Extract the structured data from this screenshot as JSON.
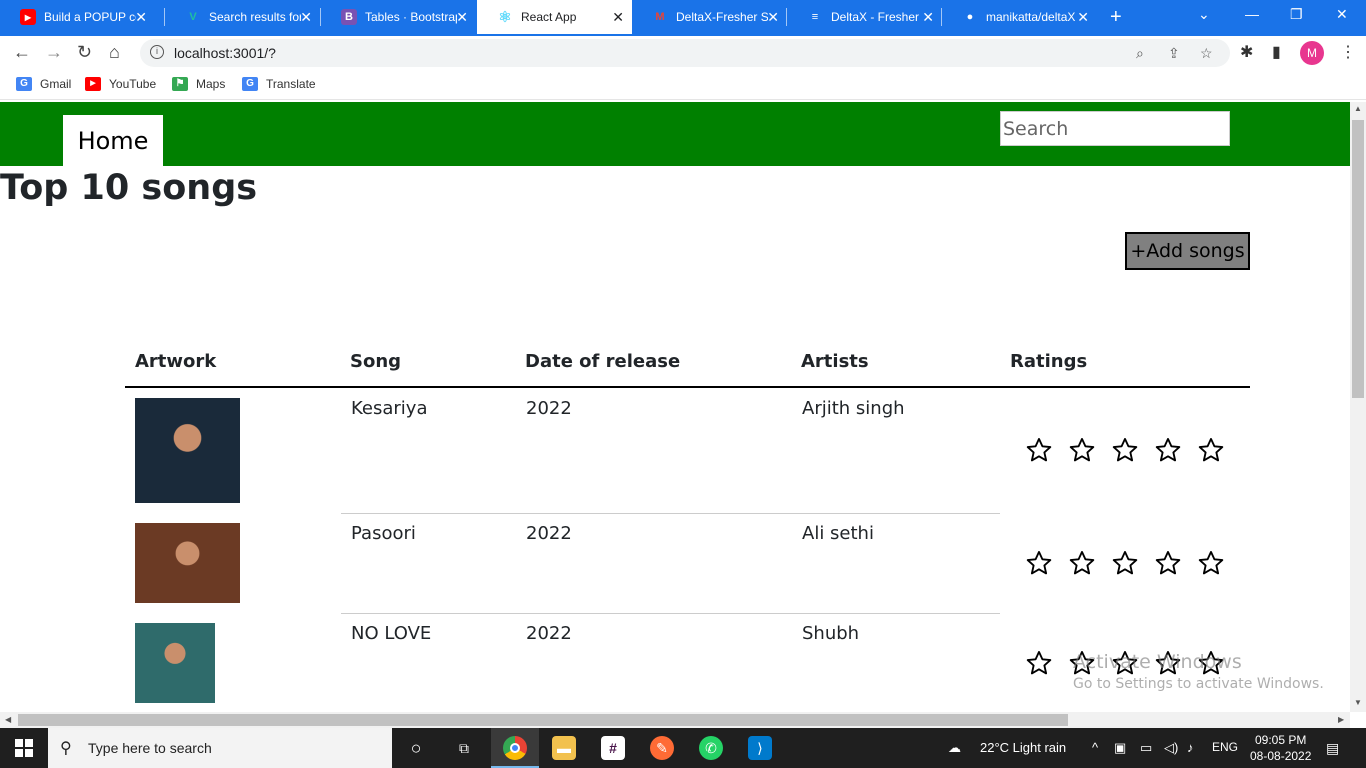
{
  "browser": {
    "tabs": [
      {
        "title": "Build a POPUP co",
        "icon": "youtube-icon",
        "color": "#ff0000"
      },
      {
        "title": "Search results for",
        "icon": "vuetify-icon",
        "color": "#1ec0a0"
      },
      {
        "title": "Tables · Bootstrap",
        "icon": "bootstrap-icon",
        "color": "#7952b3"
      },
      {
        "title": "React App",
        "icon": "react-icon",
        "color": "#61dafb"
      },
      {
        "title": "DeltaX-Fresher Sc",
        "icon": "gmail-icon",
        "color": "#ea4335"
      },
      {
        "title": "DeltaX - Fresher",
        "icon": "docs-icon",
        "color": "#ffffff"
      },
      {
        "title": "manikatta/deltaX",
        "icon": "github-icon",
        "color": "#ffffff"
      }
    ],
    "url": "localhost:3001/?",
    "profile_initial": "M",
    "bookmarks": [
      {
        "label": "Gmail",
        "icon": "google-icon",
        "color": "#4285f4"
      },
      {
        "label": "YouTube",
        "icon": "youtube-icon",
        "color": "#ff0000"
      },
      {
        "label": "Maps",
        "icon": "maps-icon",
        "color": "#34a853"
      },
      {
        "label": "Translate",
        "icon": "translate-icon",
        "color": "#4285f4"
      }
    ]
  },
  "page": {
    "nav_home": "Home",
    "search_placeholder": "Search",
    "title": "Top 10 songs",
    "add_button": "+Add songs",
    "columns": [
      "Artwork",
      "Song",
      "Date of release",
      "Artists",
      "Ratings"
    ],
    "rows": [
      {
        "song": "Kesariya",
        "date": "2022",
        "artist": "Arjith singh",
        "rating": 0,
        "art_color": "#1a2a3a"
      },
      {
        "song": "Pasoori",
        "date": "2022",
        "artist": "Ali sethi",
        "rating": 0,
        "art_color": "#6b3a24"
      },
      {
        "song": "NO LOVE",
        "date": "2022",
        "artist": "Shubh",
        "rating": 0,
        "art_color": "#2f6b6b"
      }
    ],
    "max_rating": 5
  },
  "watermark": {
    "line1": "Activate Windows",
    "line2": "Go to Settings to activate Windows."
  },
  "taskbar": {
    "search_text": "Type here to search",
    "weather": "22°C  Light rain",
    "lang": "ENG",
    "time": "09:05 PM",
    "date": "08-08-2022"
  },
  "colors": {
    "navbar": "#008000",
    "chrome_tabbar": "#1a73e8"
  }
}
